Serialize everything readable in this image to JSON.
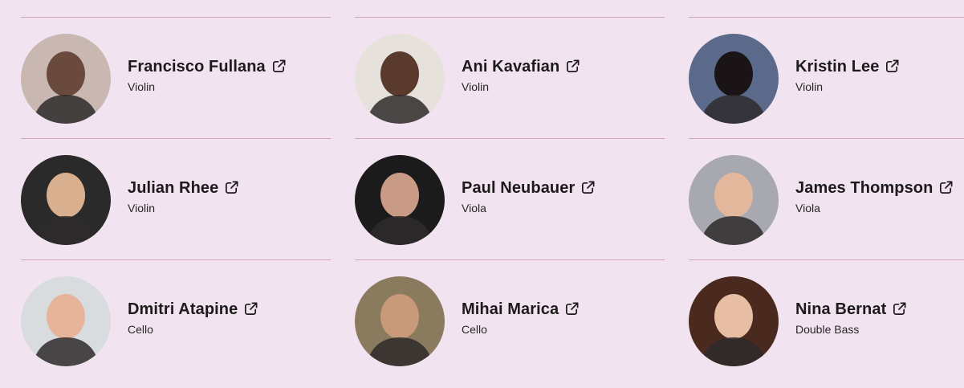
{
  "musicians": [
    {
      "name": "Francisco Fullana",
      "instrument": "Violin",
      "icon": "external-link-icon",
      "photo_bg": "#c9b8b2",
      "photo_fg": "#6b4a3e"
    },
    {
      "name": "Ani Kavafian",
      "instrument": "Violin",
      "icon": "external-link-icon",
      "photo_bg": "#e6e2db",
      "photo_fg": "#5a3a2c"
    },
    {
      "name": "Kristin Lee",
      "instrument": "Violin",
      "icon": "external-link-icon",
      "photo_bg": "#5b6a8a",
      "photo_fg": "#1a1416"
    },
    {
      "name": "Julian Rhee",
      "instrument": "Violin",
      "icon": "external-link-icon",
      "photo_bg": "#2a2a2a",
      "photo_fg": "#d9b08f"
    },
    {
      "name": "Paul Neubauer",
      "instrument": "Viola",
      "icon": "external-link-icon",
      "photo_bg": "#1c1b1b",
      "photo_fg": "#c99b86"
    },
    {
      "name": "James Thompson",
      "instrument": "Viola",
      "icon": "external-link-icon",
      "photo_bg": "#a8a8b0",
      "photo_fg": "#e2b79b"
    },
    {
      "name": "Dmitri Atapine",
      "instrument": "Cello",
      "icon": "external-link-icon",
      "photo_bg": "#d8dcde",
      "photo_fg": "#e6b49a"
    },
    {
      "name": "Mihai Marica",
      "instrument": "Cello",
      "icon": "external-link-icon",
      "photo_bg": "#8a7a5e",
      "photo_fg": "#c89a7a"
    },
    {
      "name": "Nina Bernat",
      "instrument": "Double Bass",
      "icon": "external-link-icon",
      "photo_bg": "#4a2a1e",
      "photo_fg": "#e7bda3"
    }
  ]
}
